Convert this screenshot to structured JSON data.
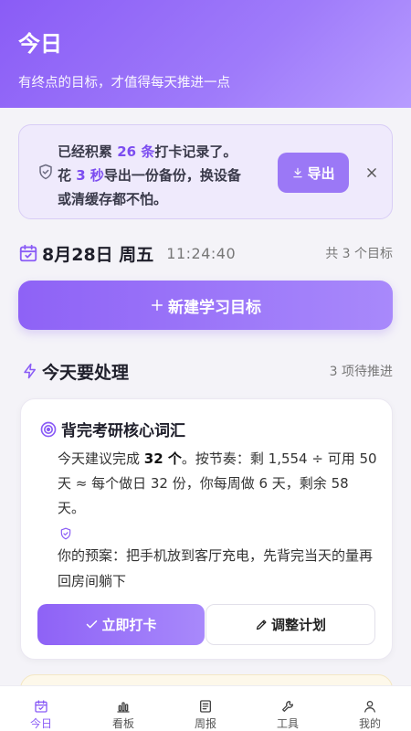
{
  "header": {
    "title": "今日",
    "subtitle": "有终点的目标，才值得每天推进一点"
  },
  "backup": {
    "line1_pre": "已经积累 ",
    "count": "26 条",
    "line1_post": "打卡记录了。",
    "line2_pre": "花 ",
    "seconds": "3 秒",
    "line2_post": "导出一份备份，换设备",
    "line3": "或清缓存都不怕。",
    "export_label": "导出",
    "colors": {
      "accent": "#7c4df0",
      "background": "#efeafc"
    }
  },
  "date": {
    "date_label": "8月28日 周五",
    "time": "11:24:40",
    "goal_count": "共 3 个目标"
  },
  "new_goal": {
    "label": "新建学习目标"
  },
  "section": {
    "title": "今天要处理",
    "count": "3 项待推进"
  },
  "task": {
    "title": "背完考研核心词汇",
    "desc_pre": "今天建议完成 ",
    "desc_amount": "32 个",
    "desc_post": "。按节奏：剩 1,554 ÷ 可用 50 天 ≈ 每个做日 32 份，你每周做 6 天，剩余 58 天。",
    "plan": "你的预案：把手机放到客厅充电，先背完当天的量再回房间躺下",
    "checkin_label": "立即打卡",
    "adjust_label": "调整计划"
  },
  "tabs": [
    {
      "label": "今日",
      "icon": "calendar-icon",
      "active": true
    },
    {
      "label": "看板",
      "icon": "bar-chart-icon",
      "active": false
    },
    {
      "label": "周报",
      "icon": "document-icon",
      "active": false
    },
    {
      "label": "工具",
      "icon": "wrench-icon",
      "active": false
    },
    {
      "label": "我的",
      "icon": "user-icon",
      "active": false
    }
  ]
}
